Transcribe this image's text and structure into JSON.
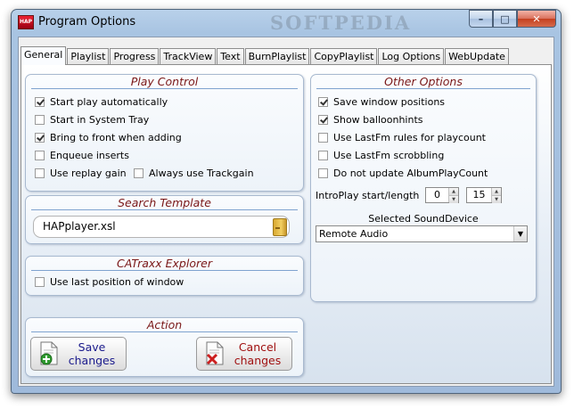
{
  "window": {
    "title": "Program Options",
    "watermark": "SOFTPEDIA",
    "app_icon_text": "HAP",
    "controls": {
      "minimize": "–",
      "maximize": "□",
      "close": "✕"
    }
  },
  "tabs": [
    "General",
    "Playlist",
    "Progress",
    "TrackView",
    "Text",
    "BurnPlaylist",
    "CopyPlaylist",
    "Log Options",
    "WebUpdate"
  ],
  "active_tab": "General",
  "play_control": {
    "title": "Play Control",
    "options": [
      {
        "label": "Start play automatically",
        "checked": true
      },
      {
        "label": "Start in System Tray",
        "checked": false
      },
      {
        "label": "Bring to front when adding",
        "checked": true
      },
      {
        "label": "Enqueue inserts",
        "checked": false
      },
      {
        "label": "Use replay gain",
        "checked": false
      },
      {
        "label": "Always use Trackgain",
        "checked": false
      }
    ]
  },
  "search_template": {
    "title": "Search Template",
    "value": "HAPplayer.xsl",
    "browse_icon": "folder-icon"
  },
  "catraxx": {
    "title": "CATraxx Explorer",
    "options": [
      {
        "label": "Use last position of window",
        "checked": false
      }
    ]
  },
  "action": {
    "title": "Action",
    "save_label": "Save\nchanges",
    "save_color": "#1a1a8c",
    "cancel_label": "Cancel\nchanges",
    "cancel_color": "#a01010"
  },
  "other_options": {
    "title": "Other Options",
    "options": [
      {
        "label": "Save window positions",
        "checked": true
      },
      {
        "label": "Show balloonhints",
        "checked": true
      },
      {
        "label": "Use LastFm rules for playcount",
        "checked": false
      },
      {
        "label": "Use LastFm scrobbling",
        "checked": false
      },
      {
        "label": "Do not update AlbumPlayCount",
        "checked": false
      }
    ],
    "intro_label": "IntroPlay start/length",
    "intro_start": "0",
    "intro_length": "15",
    "sound_device_label": "Selected SoundDevice",
    "sound_device_value": "Remote Audio"
  },
  "colors": {
    "panel_title": "#7a1717",
    "window_frame": "#a8c4e2"
  }
}
